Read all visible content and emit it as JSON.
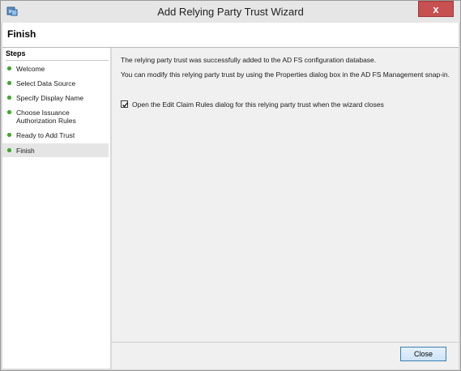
{
  "window": {
    "title": "Add Relying Party Trust Wizard",
    "close_glyph": "x"
  },
  "header": {
    "title": "Finish"
  },
  "steps": {
    "heading": "Steps",
    "items": [
      {
        "label": "Welcome",
        "status": "complete"
      },
      {
        "label": "Select Data Source",
        "status": "complete"
      },
      {
        "label": "Specify Display Name",
        "status": "complete"
      },
      {
        "label": "Choose Issuance Authorization Rules",
        "status": "complete"
      },
      {
        "label": "Ready to Add Trust",
        "status": "complete"
      },
      {
        "label": "Finish",
        "status": "current"
      }
    ]
  },
  "content": {
    "message_1": "The relying party trust was successfully added to the AD FS configuration database.",
    "message_2": "You can modify this relying party trust by using the Properties dialog box in the AD FS Management snap-in.",
    "checkbox_label": "Open the Edit Claim Rules dialog for this relying party trust when the wizard closes",
    "checkbox_checked": true
  },
  "footer": {
    "close_label": "Close"
  },
  "colors": {
    "step_complete": "#3fae2a",
    "title_close_bg": "#c75050",
    "button_border": "#3c7fb1"
  },
  "icons": {
    "app_icon": "trust-wizard-icon"
  }
}
